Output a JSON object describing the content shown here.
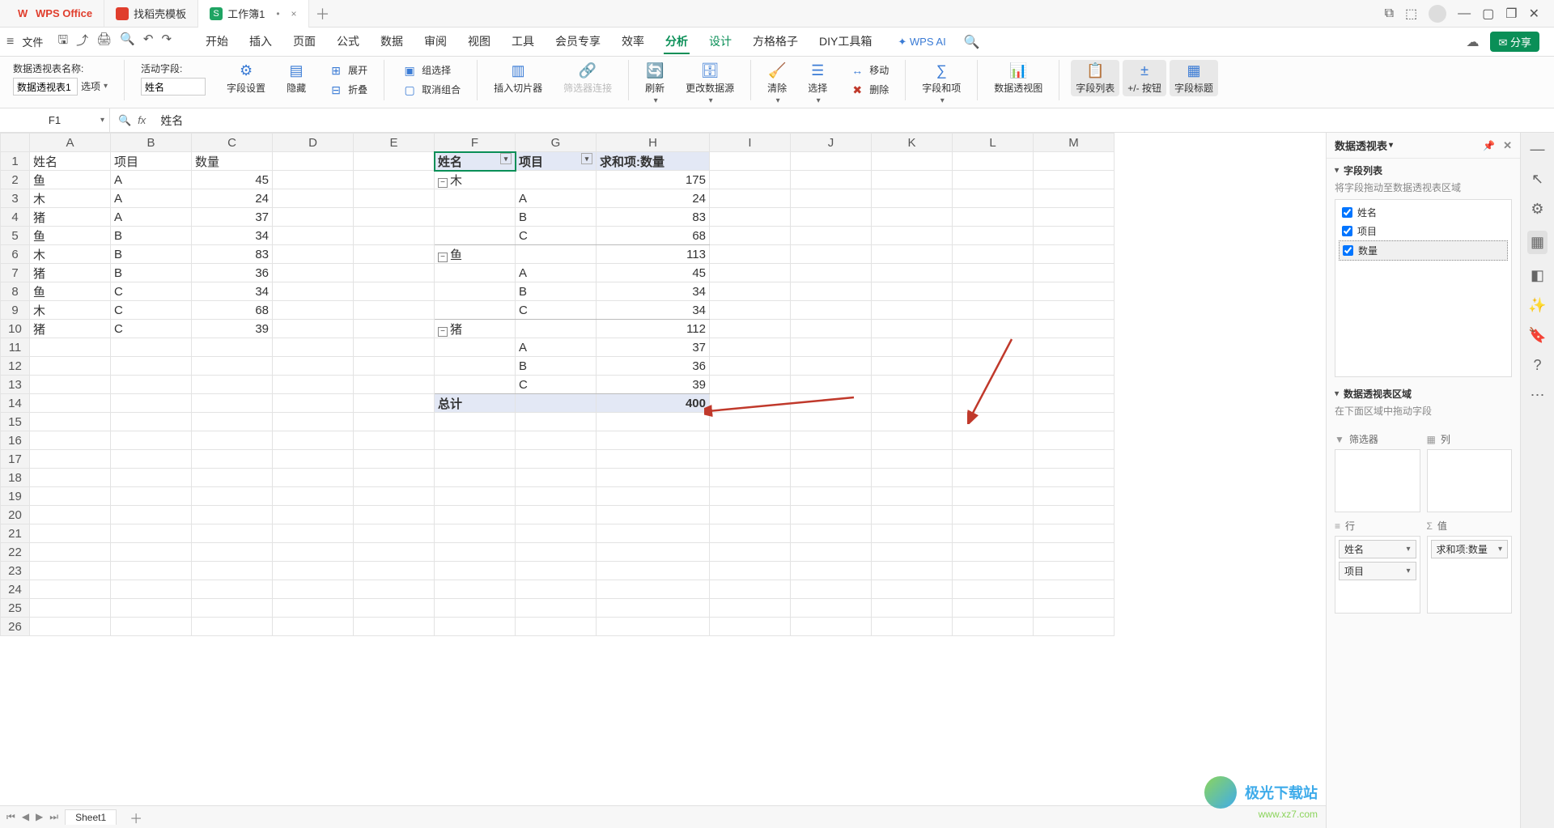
{
  "title_tabs": {
    "app": "WPS Office",
    "template": "找稻壳模板",
    "doc": "工作簿1"
  },
  "file_menu": "文件",
  "ribbon_tabs": [
    "开始",
    "插入",
    "页面",
    "公式",
    "数据",
    "审阅",
    "视图",
    "工具",
    "会员专享",
    "效率",
    "分析",
    "设计",
    "方格格子",
    "DIY工具箱"
  ],
  "wps_ai": "WPS AI",
  "share": "分享",
  "ribbon": {
    "name_lbl": "数据透视表名称:",
    "name_val": "数据透视表1",
    "opt": "选项",
    "activef_lbl": "活动字段:",
    "activef_val": "姓名",
    "field_set": "字段设置",
    "hide": "隐藏",
    "expand": "展开",
    "collapse": "折叠",
    "group": "组选择",
    "ungroup": "取消组合",
    "slicer": "插入切片器",
    "slink": "筛选器连接",
    "refresh": "刷新",
    "change_src": "更改数据源",
    "clear": "清除",
    "select": "选择",
    "move": "移动",
    "delete": "删除",
    "calc": "字段和项",
    "pchart": "数据透视图",
    "flist": "字段列表",
    "pmbtn": "+/- 按钮",
    "fhdr": "字段标题"
  },
  "formula": {
    "cellref": "F1",
    "value": "姓名"
  },
  "columns": [
    "A",
    "B",
    "C",
    "D",
    "E",
    "F",
    "G",
    "H",
    "I",
    "J",
    "K",
    "L",
    "M"
  ],
  "rows": 26,
  "src_data": {
    "headers": {
      "A": "姓名",
      "B": "项目",
      "C": "数量"
    },
    "rows": [
      {
        "A": "鱼",
        "B": "A",
        "C": 45
      },
      {
        "A": "木",
        "B": "A",
        "C": 24
      },
      {
        "A": "猪",
        "B": "A",
        "C": 37
      },
      {
        "A": "鱼",
        "B": "B",
        "C": 34
      },
      {
        "A": "木",
        "B": "B",
        "C": 83
      },
      {
        "A": "猪",
        "B": "B",
        "C": 36
      },
      {
        "A": "鱼",
        "B": "C",
        "C": 34
      },
      {
        "A": "木",
        "B": "C",
        "C": 68
      },
      {
        "A": "猪",
        "B": "C",
        "C": 39
      }
    ]
  },
  "pivot": {
    "hdr": {
      "F": "姓名",
      "G": "项目",
      "H": "求和项:数量"
    },
    "groups": [
      {
        "name": "木",
        "subtotal": 175,
        "items": [
          [
            "A",
            24
          ],
          [
            "B",
            83
          ],
          [
            "C",
            68
          ]
        ]
      },
      {
        "name": "鱼",
        "subtotal": 113,
        "items": [
          [
            "A",
            45
          ],
          [
            "B",
            34
          ],
          [
            "C",
            34
          ]
        ]
      },
      {
        "name": "猪",
        "subtotal": 112,
        "items": [
          [
            "A",
            37
          ],
          [
            "B",
            36
          ],
          [
            "C",
            39
          ]
        ]
      }
    ],
    "total_lbl": "总计",
    "total": 400
  },
  "panel": {
    "title": "数据透视表",
    "sec_fieldlist": "字段列表",
    "desc1": "将字段拖动至数据透视表区域",
    "fields": [
      "姓名",
      "项目",
      "数量"
    ],
    "sec_areas": "数据透视表区域",
    "desc2": "在下面区域中拖动字段",
    "area_filter": "筛选器",
    "area_col": "列",
    "area_row": "行",
    "area_val": "值",
    "rows": [
      "姓名",
      "项目"
    ],
    "vals": [
      "求和项:数量"
    ]
  },
  "sheet_tab": "Sheet1",
  "watermark": {
    "name": "极光下载站",
    "url": "www.xz7.com"
  }
}
